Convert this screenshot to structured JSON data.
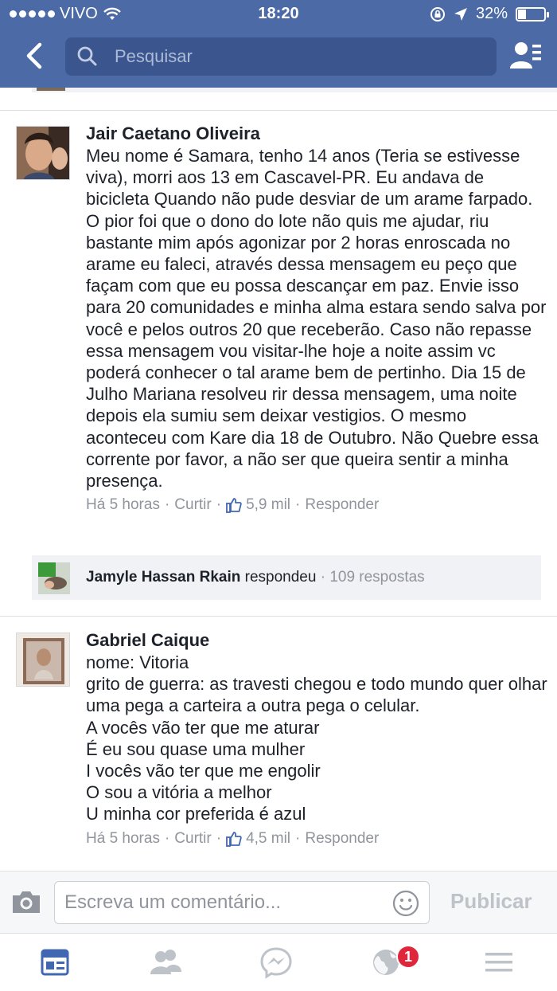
{
  "status_bar": {
    "carrier": "VIVO",
    "time": "18:20",
    "battery": "32%",
    "battery_level": 0.32
  },
  "header": {
    "search_placeholder": "Pesquisar",
    "icons": [
      "chevron-left-icon",
      "search-icon",
      "friend-requests-icon"
    ]
  },
  "comments": [
    {
      "author": "Jair Caetano Oliveira",
      "text": "Meu nome é Samara, tenho 14 anos (Teria se estivesse viva), morri aos 13 em Cascavel-PR. Eu andava de bicicleta Quando não pude desviar de um arame farpado. O pior foi que o dono do lote não quis me ajudar, riu bastante mim após agonizar por 2 horas enroscada no arame eu faleci, através dessa mensagem eu peço que façam com que eu possa descançar em paz. Envie isso para 20 comunidades e minha alma estara sendo salva por você e pelos outros 20 que receberão. Caso não repasse essa mensagem vou visitar-lhe hoje a noite assim vc poderá conhecer o tal arame bem de pertinho. Dia 15 de Julho Mariana resolveu rir dessa mensagem, uma noite depois ela sumiu sem deixar vestigios. O mesmo aconteceu com Kare dia 18 de Outubro. Não Quebre essa corrente por favor, a não ser que queira sentir a minha presença.",
      "time": "Há 5 horas",
      "like_label": "Curtir",
      "likes": "5,9 mil",
      "reply_label": "Responder",
      "reply_preview": {
        "name": "Jamyle Hassan Rkain",
        "action": "respondeu",
        "count": "109 respostas"
      }
    },
    {
      "author": "Gabriel Caique",
      "text": "nome: Vitoria\ngrito de guerra: as travesti chegou e todo mundo quer olhar uma pega a carteira a outra pega o celular.\nA vocês vão ter que me aturar\nÉ eu sou quase uma mulher\nI vocês vão ter que me engolir\nO sou a vitória a melhor\nU minha cor preferida é azul",
      "time": "Há 5 horas",
      "like_label": "Curtir",
      "likes": "4,5 mil",
      "reply_label": "Responder"
    }
  ],
  "composer": {
    "placeholder": "Escreva um comentário...",
    "publish_label": "Publicar"
  },
  "tabbar": {
    "tabs": [
      "news-feed-icon",
      "friends-icon",
      "messenger-icon",
      "notifications-globe-icon",
      "menu-icon"
    ],
    "notification_badge": "1"
  },
  "colors": {
    "header_bg": "#4b6aa6",
    "search_bg": "#3b568f",
    "muted_text": "#90949c",
    "like_blue": "#4267b2",
    "badge_red": "#e0263b",
    "active_tab": "#4267b2"
  }
}
